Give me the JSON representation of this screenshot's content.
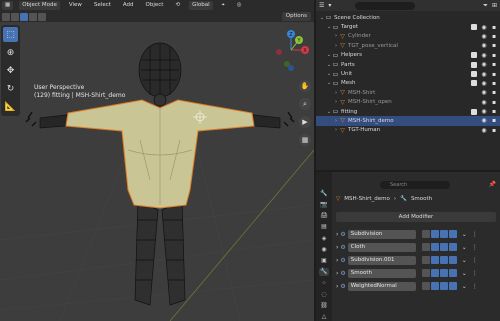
{
  "viewport": {
    "mode": "Object Mode",
    "menu": [
      "View",
      "Select",
      "Add",
      "Object"
    ],
    "transform_orientation": "Global",
    "options": "Options",
    "view_name": "User Perspective",
    "view_info": "(129) fitting | MSH-Shirt_demo",
    "gizmo_axes": {
      "x": "X",
      "y": "Y",
      "z": "Z"
    },
    "axis_colors": {
      "x": "#d3394b",
      "y": "#8ac53a",
      "z": "#3b85d9"
    }
  },
  "outliner": {
    "search_placeholder": "",
    "rows": [
      {
        "label": "Scene Collection",
        "indent": 0,
        "icon": "collection-icon",
        "color": "#ddd"
      },
      {
        "label": "Target",
        "indent": 1,
        "icon": "collection-icon",
        "color": "#ddd",
        "check": true
      },
      {
        "label": "Cylinder",
        "indent": 2,
        "icon": "mesh-icon",
        "dim": true
      },
      {
        "label": "TGT_pose_vertical",
        "indent": 2,
        "icon": "mesh-icon",
        "dim": true
      },
      {
        "label": "Helpers",
        "indent": 1,
        "icon": "collection-icon",
        "check": true
      },
      {
        "label": "Parts",
        "indent": 1,
        "icon": "collection-icon",
        "check": true
      },
      {
        "label": "Unit",
        "indent": 1,
        "icon": "collection-icon",
        "check": true
      },
      {
        "label": "Mesh",
        "indent": 1,
        "icon": "collection-icon",
        "check": true
      },
      {
        "label": "MSH-Shirt",
        "indent": 2,
        "icon": "mesh-icon",
        "dim": true
      },
      {
        "label": "MSH-Shirt_open",
        "indent": 2,
        "icon": "mesh-icon",
        "dim": true
      },
      {
        "label": "fitting",
        "indent": 1,
        "icon": "collection-icon",
        "check": true
      },
      {
        "label": "MSH-Shirt_demo",
        "indent": 2,
        "icon": "mesh-icon",
        "selected": true
      },
      {
        "label": "TGT-Human",
        "indent": 2,
        "icon": "mesh-icon"
      }
    ]
  },
  "properties": {
    "search_placeholder": "Search",
    "object_name": "MSH-Shirt_demo",
    "active_modifier": "Smooth",
    "add_modifier": "Add Modifier",
    "modifiers": [
      "Subdivision",
      "Cloth",
      "Subdivision.001",
      "Smooth",
      "WeightedNormal"
    ]
  }
}
